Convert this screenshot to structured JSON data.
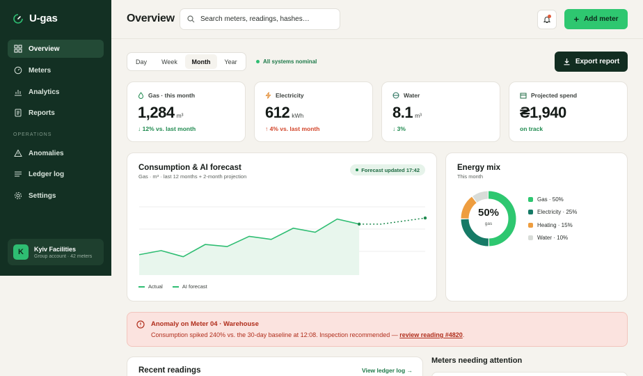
{
  "app": {
    "name": "U-gas"
  },
  "sidebar": {
    "items": [
      {
        "label": "Overview",
        "icon": "grid-icon",
        "active": true
      },
      {
        "label": "Meters",
        "icon": "gauge-icon"
      },
      {
        "label": "Analytics",
        "icon": "bar-chart-icon"
      },
      {
        "label": "Reports",
        "icon": "document-icon"
      }
    ],
    "section_label": "OPERATIONS",
    "ops_items": [
      {
        "label": "Anomalies",
        "icon": "warning-icon"
      },
      {
        "label": "Ledger log",
        "icon": "list-icon"
      },
      {
        "label": "Settings",
        "icon": "gear-icon"
      }
    ],
    "account": {
      "initial": "K",
      "name": "Kyiv Facilities",
      "sub": "Group account · 42 meters"
    }
  },
  "header": {
    "title": "Overview",
    "search_placeholder": "Search meters, readings, hashes…",
    "add_button": "Add meter"
  },
  "toolbar": {
    "ranges": [
      "Day",
      "Week",
      "Month",
      "Year"
    ],
    "selected_range": "Month",
    "status": "All systems nominal",
    "export_button": "Export report"
  },
  "kpis": [
    {
      "label": "Gas · this month",
      "value": "1,284",
      "unit": "m³",
      "delta": "↓ 12% vs. last month",
      "tone": "green",
      "icon": "flame-icon"
    },
    {
      "label": "Electricity",
      "value": "612",
      "unit": "kWh",
      "delta": "↑ 4% vs. last month",
      "tone": "red",
      "icon": "bolt-icon"
    },
    {
      "label": "Water",
      "value": "8.1",
      "unit": "m³",
      "delta": "↓ 3%",
      "tone": "green",
      "icon": "water-icon"
    },
    {
      "label": "Projected spend",
      "value": "₴1,940",
      "unit": "",
      "delta": "on track",
      "tone": "green",
      "icon": "calendar-icon"
    }
  ],
  "consumption": {
    "title": "Consumption & AI forecast",
    "subtitle": "Gas · m³ · last 12 months + 2-month projection",
    "badge": "Forecast updated 17:42",
    "legend": [
      "Actual",
      "AI forecast"
    ]
  },
  "chart_data": {
    "type": "line",
    "series": [
      {
        "name": "Actual",
        "values": [
          20,
          24,
          18,
          30,
          28,
          38,
          35,
          46,
          42,
          55,
          50
        ]
      },
      {
        "name": "AI forecast",
        "values": [
          50,
          53,
          56
        ]
      }
    ],
    "forecast_start_index": 10,
    "ylim": [
      0,
      80
    ],
    "grid": true,
    "colors": {
      "line": "#2ebd72",
      "fill": "#e8f6ed"
    }
  },
  "energy_mix": {
    "title": "Energy mix",
    "subtitle": "This month",
    "center_value": "50%",
    "center_label": "gas",
    "items": [
      {
        "label": "Gas · 50%",
        "value": 50,
        "color": "#2ec770"
      },
      {
        "label": "Electricity · 25%",
        "value": 25,
        "color": "#167a66"
      },
      {
        "label": "Heating · 15%",
        "value": 15,
        "color": "#ee9d3f"
      },
      {
        "label": "Water · 10%",
        "value": 10,
        "color": "#d8dcd8"
      }
    ]
  },
  "alert": {
    "title": "Anomaly on Meter 04 · Warehouse",
    "text": "Consumption spiked 240% vs. the 30-day baseline at 12:08. Inspection recommended — ",
    "link": "review reading #4820",
    "suffix": "."
  },
  "recent": {
    "title": "Recent readings",
    "link": "View ledger log →"
  },
  "attention": {
    "title": "Meters needing attention"
  }
}
